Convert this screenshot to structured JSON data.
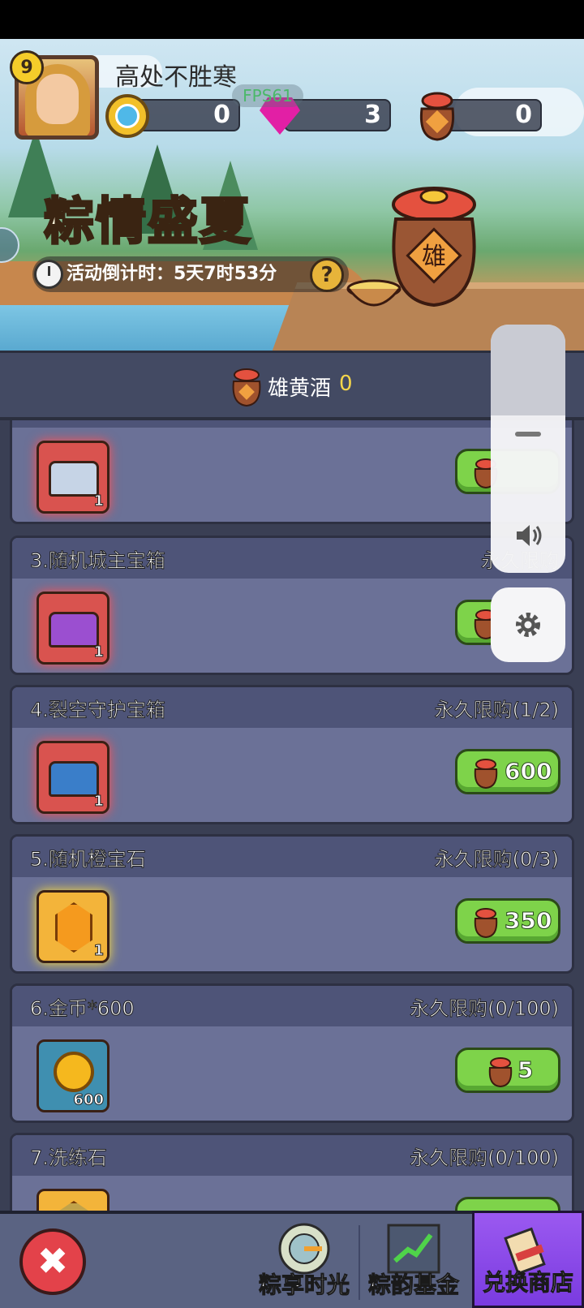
{
  "header": {
    "level": "9",
    "player_name": "高处不胜寒",
    "fps": "FPS61",
    "resources": [
      {
        "name": "diamond",
        "icon": "diamond-coin-icon",
        "value": "0"
      },
      {
        "name": "gem",
        "icon": "pink-gem-icon",
        "value": "3"
      },
      {
        "name": "wine",
        "icon": "wine-jar-icon",
        "value": "0"
      }
    ]
  },
  "banner": {
    "title": "粽情盛夏",
    "countdown": "活动倒计时：5天7时53分",
    "help_label": "?",
    "jar_label": "雄"
  },
  "currency": {
    "label": "雄黄酒",
    "count": "0"
  },
  "shop_items": [
    {
      "title": "",
      "limit": "",
      "count": "1",
      "price": "",
      "icon": "chest-icon"
    },
    {
      "title": "3.随机城主宝箱",
      "limit": "永久限购",
      "count": "1",
      "price": "",
      "icon": "crown-chest-icon"
    },
    {
      "title": "4.裂空守护宝箱",
      "limit": "永久限购(1/2)",
      "count": "1",
      "price": "600",
      "icon": "mystery-chest-icon"
    },
    {
      "title": "5.随机橙宝石",
      "limit": "永久限购(0/3)",
      "count": "1",
      "price": "350",
      "icon": "orange-gem-icon"
    },
    {
      "title": "6.金币*600",
      "limit": "永久限购(0/100)",
      "count": "600",
      "price": "5",
      "icon": "gold-coin-icon"
    },
    {
      "title": "7.洗练石",
      "limit": "永久限购(0/100)",
      "count": "",
      "price": "",
      "icon": "refine-stone-icon"
    }
  ],
  "bottom_nav": {
    "close_label": "✖",
    "tabs": [
      {
        "label": "粽享时光",
        "icon": "clock-target-icon"
      },
      {
        "label": "粽韵基金",
        "icon": "growth-chart-icon"
      },
      {
        "label": "兑换商店",
        "icon": "scroll-icon"
      }
    ]
  },
  "colors": {
    "accent_purple": "#8a4bee",
    "buy_green": "#7ed34a",
    "card_bg": "#6b7197"
  }
}
